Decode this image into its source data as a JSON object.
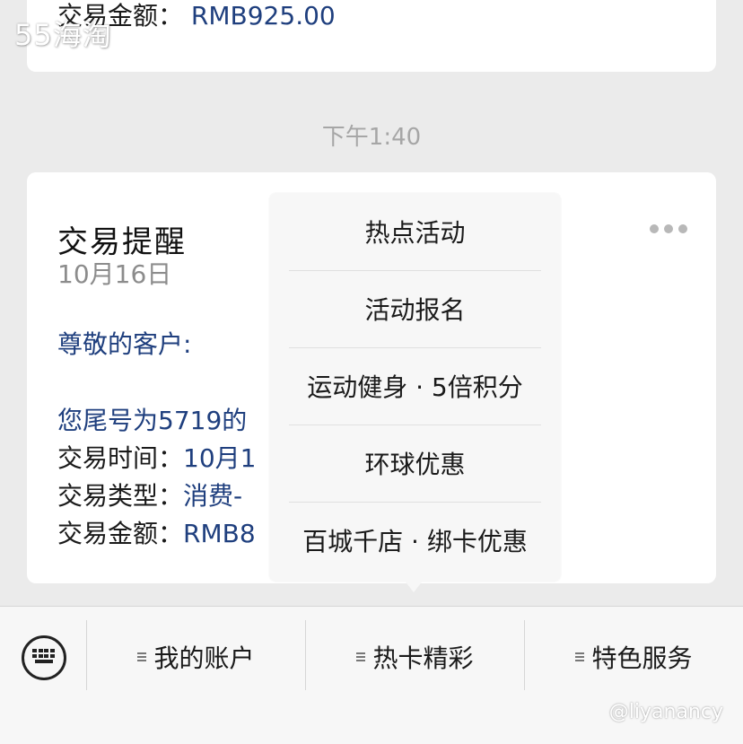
{
  "watermarks": {
    "top_left": "55海淘",
    "bottom_right": "@liyanancy"
  },
  "previous_card": {
    "amount_label": "交易金额：",
    "amount_value": "RMB925.00"
  },
  "time_divider": "下午1:40",
  "message_card": {
    "title": "交易提醒",
    "date": "10月16日",
    "greeting": "尊敬的客户:",
    "notice_partial": "您尾号为5719的",
    "rows": [
      {
        "label": "交易时间：",
        "value": "10月1"
      },
      {
        "label": "交易类型：",
        "value": "消费-"
      },
      {
        "label": "交易金额：",
        "value": "RMB8"
      }
    ],
    "more_icon": "more-dots-icon"
  },
  "popup_menu": {
    "items": [
      "热点活动",
      "活动报名",
      "运动健身 · 5倍积分",
      "环球优惠",
      "百城千店 · 绑卡优惠"
    ]
  },
  "bottom_menu": {
    "keyboard_icon": "keyboard-icon",
    "buttons": [
      "我的账户",
      "热卡精彩",
      "特色服务"
    ]
  },
  "colors": {
    "link_blue": "#1f3f7e",
    "background": "#ebebeb",
    "popup_bg": "#f7f7f7"
  }
}
